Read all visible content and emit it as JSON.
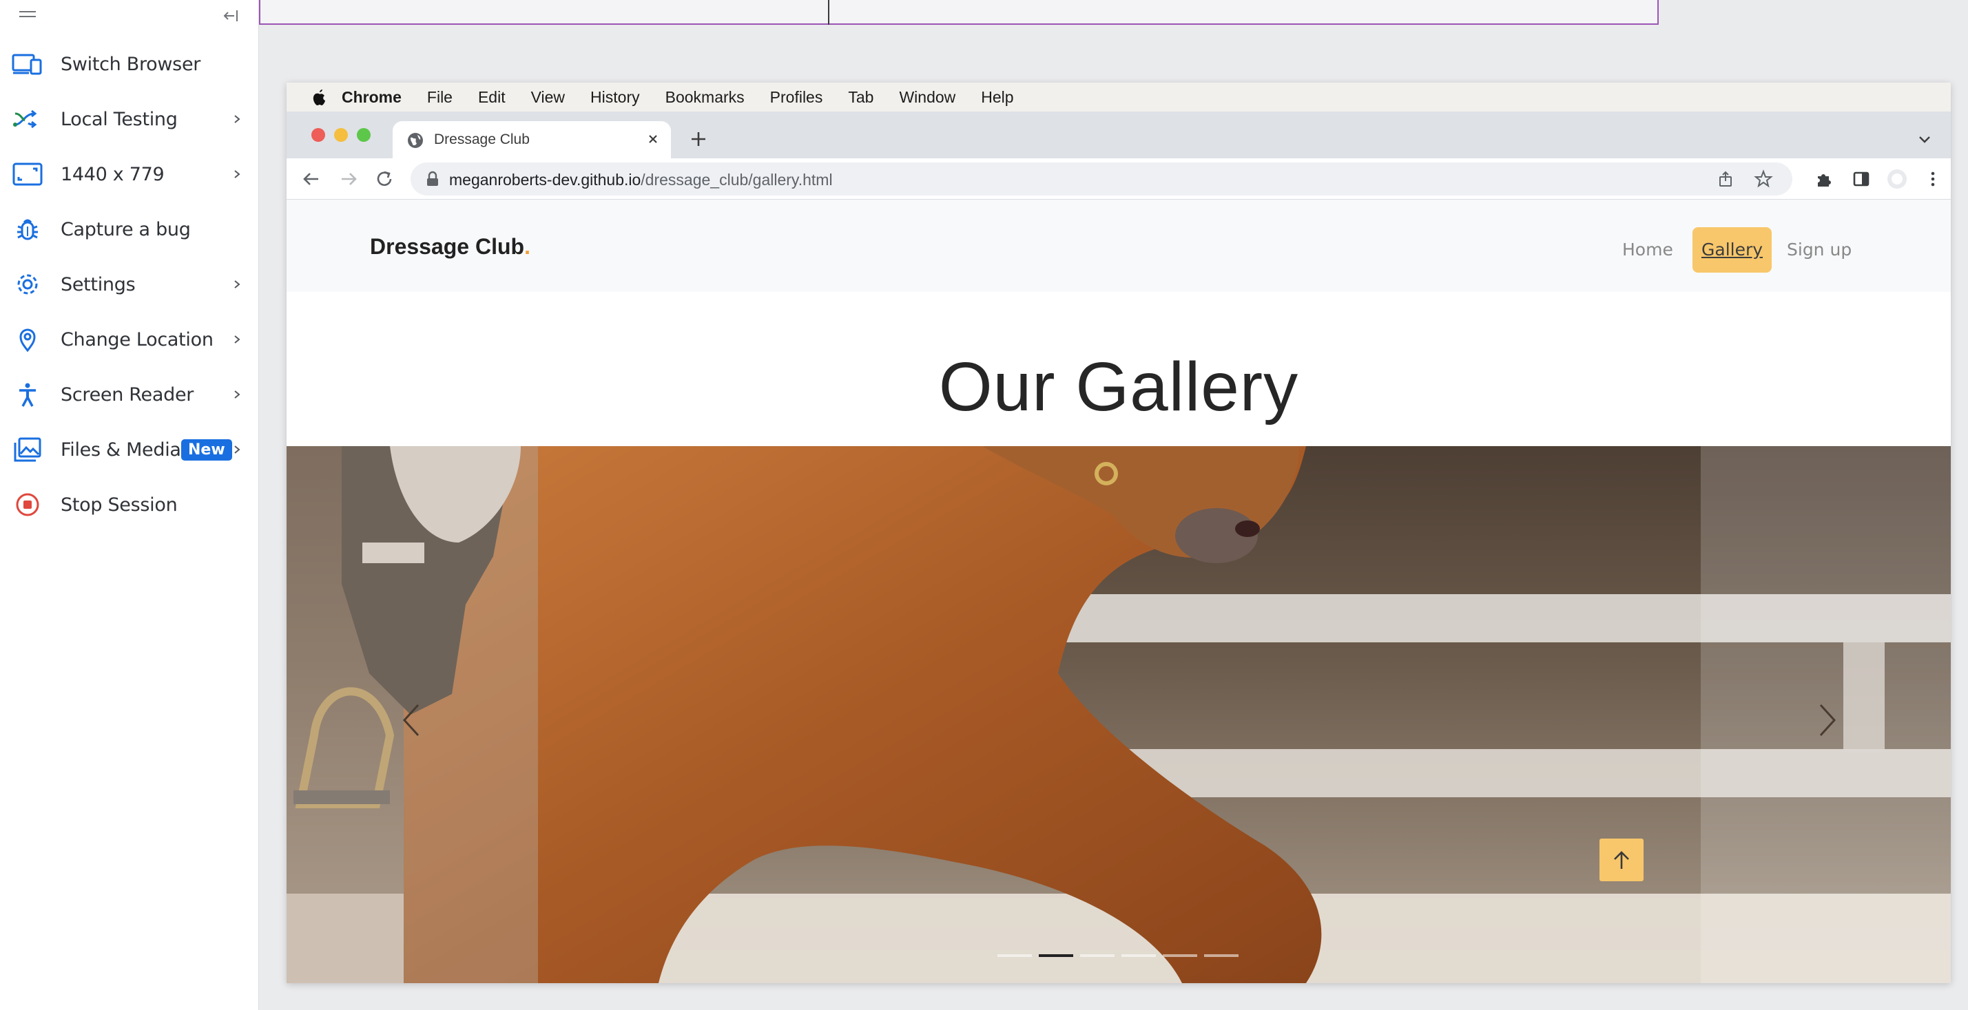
{
  "sidebar": {
    "items": [
      {
        "label": "Switch Browser",
        "icon": "devices-icon",
        "has_chevron": false
      },
      {
        "label": "Local Testing",
        "icon": "shuffle-icon",
        "has_chevron": true
      },
      {
        "label": "1440 x 779",
        "icon": "resolution-icon",
        "has_chevron": true
      },
      {
        "label": "Capture a bug",
        "icon": "bug-icon",
        "has_chevron": false
      },
      {
        "label": "Settings",
        "icon": "gear-icon",
        "has_chevron": true
      },
      {
        "label": "Change Location",
        "icon": "location-pin-icon",
        "has_chevron": true
      },
      {
        "label": "Screen Reader",
        "icon": "accessibility-icon",
        "has_chevron": true
      },
      {
        "label": "Files & Media",
        "icon": "image-icon",
        "has_chevron": true,
        "badge": "New"
      },
      {
        "label": "Stop Session",
        "icon": "stop-icon",
        "has_chevron": false
      }
    ]
  },
  "mac": {
    "menu": [
      "Chrome",
      "File",
      "Edit",
      "View",
      "History",
      "Bookmarks",
      "Profiles",
      "Tab",
      "Window",
      "Help"
    ]
  },
  "browser": {
    "tab_title": "Dressage Club",
    "url_host": "meganroberts-dev.github.io",
    "url_path": "/dressage_club/gallery.html"
  },
  "site": {
    "brand": "Dressage Club",
    "brand_dot": ".",
    "nav": [
      {
        "label": "Home",
        "active": false
      },
      {
        "label": "Gallery",
        "active": true
      },
      {
        "label": "Sign up",
        "active": false
      }
    ],
    "heading": "Our Gallery",
    "carousel": {
      "slide_count": 6,
      "active_index": 1
    }
  },
  "colors": {
    "accent_blue": "#1a6fe0",
    "nav_active": "#f8c76b",
    "brand_dot": "#f0a13a",
    "stop_red": "#e0473d"
  }
}
